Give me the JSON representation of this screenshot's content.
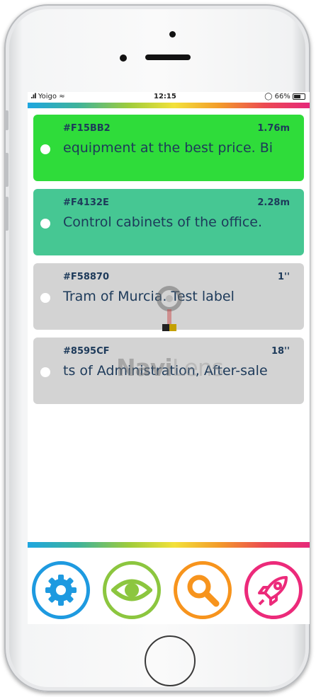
{
  "status_bar": {
    "carrier": "Yoigo",
    "time": "12:15",
    "battery": "66%"
  },
  "cards": [
    {
      "code": "#F15BB2",
      "distance": "1.76m",
      "text": "equipment at the best price. Bi",
      "color": "#2fdc3a"
    },
    {
      "code": "#F4132E",
      "distance": "2.28m",
      "text": "Control cabinets of the office.",
      "color": "#46c793"
    },
    {
      "code": "#F58870",
      "distance": "1''",
      "text": "Tram of Murcia. Test label",
      "color": "#d3d3d3"
    },
    {
      "code": "#8595CF",
      "distance": "18''",
      "text": "ts of Administration, After-sale",
      "color": "#d3d3d3"
    }
  ],
  "watermark": {
    "part1": "Navi",
    "part2": "Lens"
  },
  "toolbar": {
    "buttons": [
      {
        "icon": "gear-icon",
        "color": "#1e9ae0"
      },
      {
        "icon": "eye-icon",
        "color": "#8cc63f"
      },
      {
        "icon": "search-icon",
        "color": "#f7941d"
      },
      {
        "icon": "rocket-icon",
        "color": "#ec2a7a"
      }
    ]
  }
}
